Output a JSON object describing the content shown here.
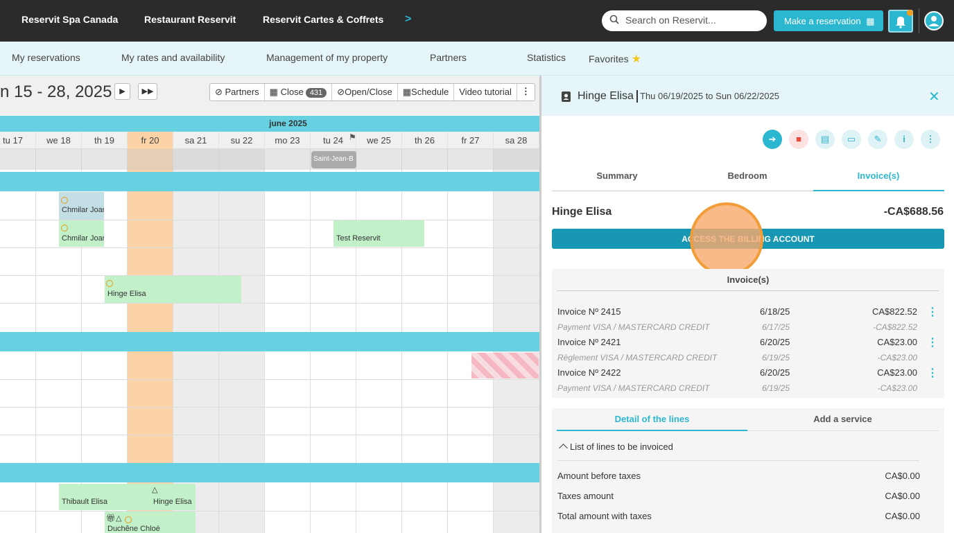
{
  "topbar": {
    "nav": [
      "Reservit Spa Canada",
      "Restaurant Reservit",
      "Reservit Cartes & Coffrets"
    ],
    "search_placeholder": "Search on Reservit...",
    "make_reservation": "Make a reservation"
  },
  "menu": {
    "items": [
      "My reservations",
      "My rates and availability",
      "Management of my property",
      "Partners",
      "Statistics",
      "Favorites"
    ]
  },
  "calendar": {
    "range": "n 15 - 28, 2025",
    "tools": {
      "partners": "Partners",
      "close": "Close",
      "close_count": "431",
      "open_close": "Open/Close",
      "schedule": "Schedule",
      "video": "Video tutorial"
    },
    "month": "june 2025",
    "days": [
      "tu 17",
      "we 18",
      "th 19",
      "fr 20",
      "sa 21",
      "su 22",
      "mo 23",
      "tu 24",
      "we 25",
      "th 26",
      "fr 27",
      "sa 28"
    ],
    "event_label": "Saint-Jean-B",
    "reservations": [
      "Chmilar Joan",
      "Chmilar Joan",
      "Test Reservit",
      "Hinge Elisa",
      "Thibault Elisa",
      "Hinge Elisa",
      "Duchêne Chloé"
    ]
  },
  "panel": {
    "guest": "Hinge Elisa",
    "dates": "Thu 06/19/2025 to Sun 06/22/2025",
    "tabs": [
      "Summary",
      "Bedroom",
      "Invoice(s)"
    ],
    "balance": "-CA$688.56",
    "billing_button": "ACCESS THE BILLING ACCOUNT",
    "invoices_title": "Invoice(s)",
    "invoices": [
      {
        "label": "Invoice Nº 2415",
        "date": "6/18/25",
        "amount": "CA$822.52",
        "pay_label": "Payment VISA / MASTERCARD CREDIT",
        "pay_date": "6/17/25",
        "pay_amount": "-CA$822.52"
      },
      {
        "label": "Invoice Nº 2421",
        "date": "6/20/25",
        "amount": "CA$23.00",
        "pay_label": "Règlement VISA / MASTERCARD CREDIT",
        "pay_date": "6/19/25",
        "pay_amount": "-CA$23.00"
      },
      {
        "label": "Invoice Nº 2422",
        "date": "6/20/25",
        "amount": "CA$23.00",
        "pay_label": "Payment VISA / MASTERCARD CREDIT",
        "pay_date": "6/19/25",
        "pay_amount": "-CA$23.00"
      }
    ],
    "detail_tabs": [
      "Detail of the lines",
      "Add a service"
    ],
    "list_label": "List of lines to be invoiced",
    "totals": [
      {
        "label": "Amount before taxes",
        "value": "CA$0.00"
      },
      {
        "label": "Taxes amount",
        "value": "CA$0.00"
      },
      {
        "label": "Total amount with taxes",
        "value": "CA$0.00"
      }
    ]
  },
  "colors": {
    "accent": "#2bb7cf",
    "billing": "#1797b2",
    "reservation": "#c2f0c9",
    "highlight_day": "#fcd3a6"
  }
}
